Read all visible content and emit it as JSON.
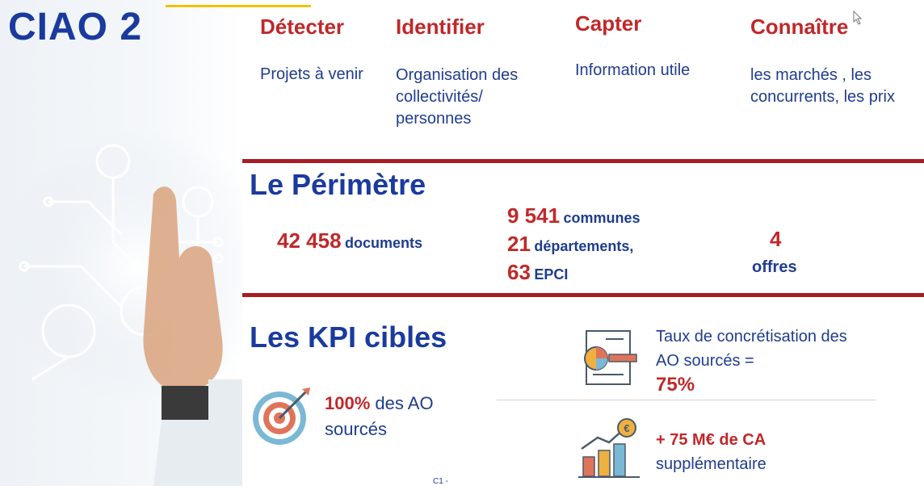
{
  "title": "CIAO 2",
  "pillars": [
    {
      "verb": "Détecter",
      "description": "Projets à venir"
    },
    {
      "verb": "Identifier",
      "description": "Organisation des collectivités/ personnes"
    },
    {
      "verb": "Capter",
      "description": "Information utile"
    },
    {
      "verb": "Connaître",
      "description": "les marchés , les concurrents, les prix"
    }
  ],
  "perimetre": {
    "title": "Le Périmètre",
    "documents": {
      "value": "42 458",
      "label": "documents"
    },
    "communes": {
      "value": "9 541",
      "label": "communes"
    },
    "departements": {
      "value": "21",
      "label": "départements,"
    },
    "epci": {
      "value": "63",
      "label": "EPCI"
    },
    "offres": {
      "value": "4",
      "label": "offres"
    }
  },
  "kpi": {
    "title": "Les KPI cibles",
    "sourced": {
      "value": "100%",
      "text_line1": "des AO",
      "text_line2": "sourcés"
    },
    "concretisation": {
      "line1": "Taux de concrétisation des",
      "line2": "AO sourcés  =",
      "value": "75%"
    },
    "ca": {
      "value": "+ 75 M€ de CA",
      "label": "supplémentaire"
    }
  },
  "footer": "C1 -",
  "colors": {
    "blue": "#1a3a9e",
    "red": "#c0282a",
    "bar": "#a81d24"
  }
}
